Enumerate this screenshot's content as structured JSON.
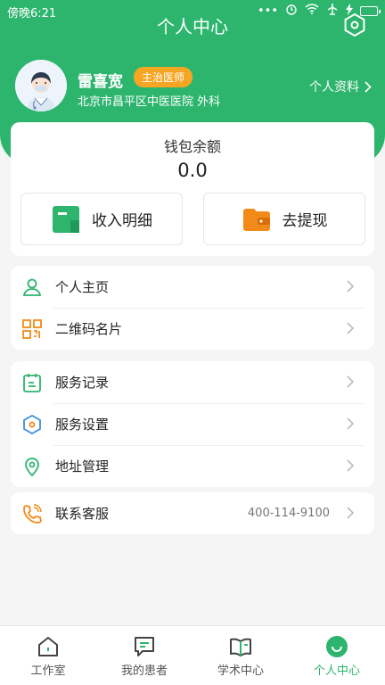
{
  "status_bar": {
    "time": "傍晚6:21"
  },
  "header": {
    "title": "个人中心"
  },
  "profile": {
    "name": "雷喜宽",
    "title_badge": "主治医师",
    "hospital": "北京市昌平区中医医院 外科",
    "profile_link": "个人资料"
  },
  "wallet": {
    "label": "钱包余额",
    "amount": "0.0",
    "income_label": "收入明细",
    "withdraw_label": "去提现"
  },
  "menu_groups": [
    {
      "items": [
        {
          "label": "个人主页"
        },
        {
          "label": "二维码名片"
        }
      ]
    },
    {
      "items": [
        {
          "label": "服务记录"
        },
        {
          "label": "服务设置"
        },
        {
          "label": "地址管理"
        }
      ]
    },
    {
      "items": [
        {
          "label": "联系客服",
          "value": "400-114-9100"
        }
      ]
    }
  ],
  "tabs": [
    {
      "label": "工作室"
    },
    {
      "label": "我的患者"
    },
    {
      "label": "学术中心"
    },
    {
      "label": "个人中心",
      "active": true
    }
  ],
  "colors": {
    "brand": "#2db56e",
    "badge": "#f6a623",
    "withdraw_icon": "#f28a1a"
  }
}
